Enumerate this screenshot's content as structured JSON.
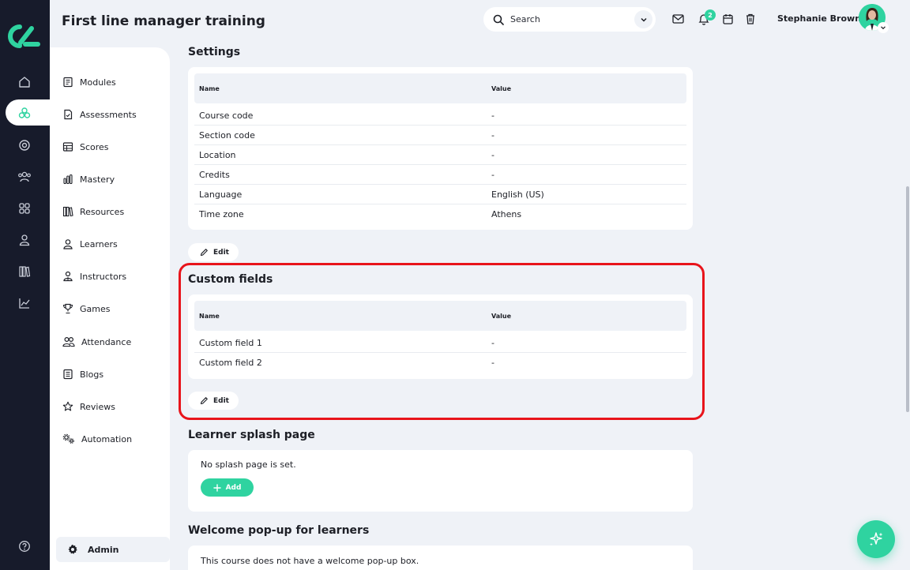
{
  "header": {
    "title": "First line manager training",
    "search_placeholder": "Search",
    "user_name": "Stephanie Brown",
    "notification_count": "2"
  },
  "subnav": {
    "items": [
      {
        "label": "Modules",
        "icon": "book-icon"
      },
      {
        "label": "Assessments",
        "icon": "document-check-icon"
      },
      {
        "label": "Scores",
        "icon": "table-icon"
      },
      {
        "label": "Mastery",
        "icon": "bar-chart-icon"
      },
      {
        "label": "Resources",
        "icon": "library-icon"
      },
      {
        "label": "Learners",
        "icon": "user-icon"
      },
      {
        "label": "Instructors",
        "icon": "instructor-icon"
      },
      {
        "label": "Games",
        "icon": "trophy-icon"
      },
      {
        "label": "Attendance",
        "icon": "users-icon"
      },
      {
        "label": "Blogs",
        "icon": "blog-icon"
      },
      {
        "label": "Reviews",
        "icon": "star-icon"
      },
      {
        "label": "Automation",
        "icon": "gears-icon"
      }
    ],
    "admin_label": "Admin"
  },
  "settings": {
    "title": "Settings",
    "col_name": "Name",
    "col_value": "Value",
    "rows": [
      {
        "name": "Course code",
        "value": "-"
      },
      {
        "name": "Section code",
        "value": "-"
      },
      {
        "name": "Location",
        "value": "-"
      },
      {
        "name": "Credits",
        "value": "-"
      },
      {
        "name": "Language",
        "value": "English (US)"
      },
      {
        "name": "Time zone",
        "value": "Athens"
      }
    ],
    "edit_label": "Edit"
  },
  "custom_fields": {
    "title": "Custom fields",
    "col_name": "Name",
    "col_value": "Value",
    "rows": [
      {
        "name": "Custom field 1",
        "value": "-"
      },
      {
        "name": "Custom field 2",
        "value": "-"
      }
    ],
    "edit_label": "Edit"
  },
  "splash": {
    "title": "Learner splash page",
    "text": "No splash page is set.",
    "add_label": "Add"
  },
  "welcome": {
    "title": "Welcome pop-up for learners",
    "text": "This course does not have a welcome pop-up box."
  },
  "colors": {
    "accent": "#2fd3a0",
    "rail": "#171b2b",
    "highlight": "#e8141b",
    "background": "#eff2f7"
  }
}
